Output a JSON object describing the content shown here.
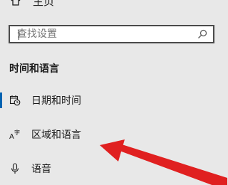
{
  "nav": {
    "home_label": "主页",
    "search_placeholder": "查找设置",
    "search_value": "",
    "section_title": "时间和语言",
    "items": [
      {
        "label": "日期和时间",
        "icon": "calendar-clock-icon",
        "selected": true
      },
      {
        "label": "区域和语言",
        "icon": "language-icon",
        "selected": false
      },
      {
        "label": "语音",
        "icon": "microphone-icon",
        "selected": false
      }
    ]
  },
  "colors": {
    "background": "#e8e8e8",
    "accent": "#0063b1",
    "annotation_arrow": "#e02020"
  }
}
